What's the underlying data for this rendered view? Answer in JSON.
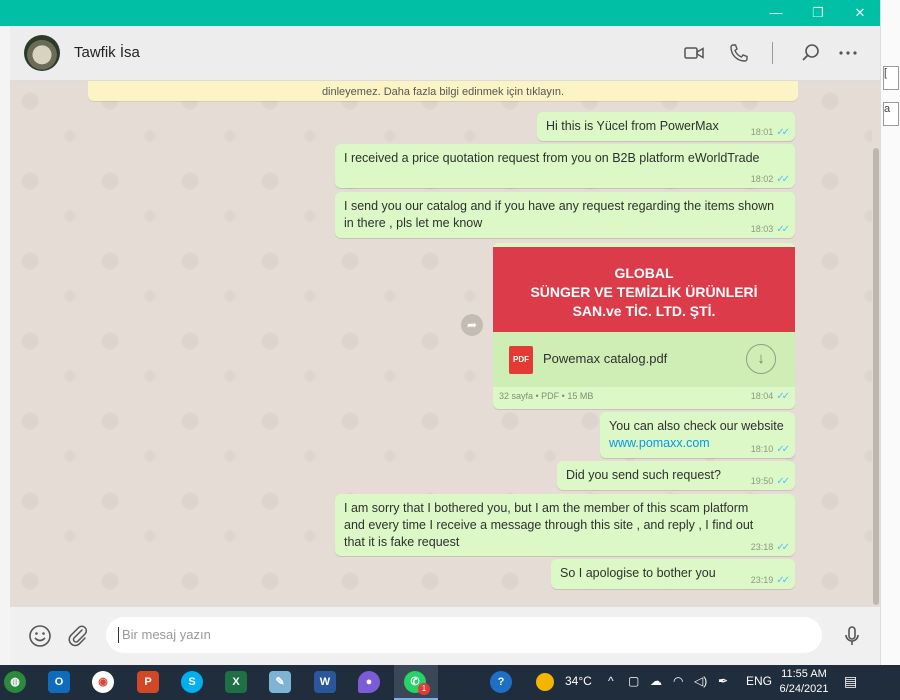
{
  "window": {
    "minimize": "—",
    "maximize": "❐",
    "close": "✕"
  },
  "side_panel": {
    "tab1": "[",
    "tab2": "a"
  },
  "header": {
    "contact_name": "Tawfik İsa",
    "icons": [
      "video-call-icon",
      "voice-call-icon",
      "search-icon",
      "menu-icon"
    ]
  },
  "notice": {
    "text": "dinleyemez. Daha fazla bilgi edinmek için tıklayın."
  },
  "messages": [
    {
      "text": "Hi this is Yücel from PowerMax",
      "time": "18:01"
    },
    {
      "text": "I received a price quotation request from you on B2B platform eWorldTrade",
      "time": "18:02"
    },
    {
      "line1": "I send you our catalog and if you have any request regarding the items shown",
      "line2": "in there , pls let me know",
      "time": "18:03"
    },
    {
      "line1": "You can also check our website",
      "link": "www.pomaxx.com",
      "time": "18:10"
    },
    {
      "text": "Did you send such request?",
      "time": "19:50"
    },
    {
      "line1": "I am sorry that I bothered you, but I am the member of this scam platform",
      "line2": "and every time I receive a message through this site , and reply , I find out",
      "line3": "that it is fake request",
      "time": "23:18"
    },
    {
      "text": "So I apologise to bother you",
      "time": "23:19"
    }
  ],
  "document": {
    "banner_line1": "GLOBAL",
    "banner_line2": "SÜNGER VE TEMİZLİK ÜRÜNLERİ",
    "banner_line3": "SAN.ve TİC. LTD. ŞTİ.",
    "file_type": "PDF",
    "file_name": "Powemax catalog.pdf",
    "meta": "32 sayfa • PDF • 15 MB",
    "time": "18:04"
  },
  "ticks": "✓✓",
  "input": {
    "placeholder": "Bir mesaj yazın"
  },
  "taskbar": {
    "apps": [
      "outlook",
      "chrome",
      "powerpoint",
      "skype",
      "excel",
      "notepad",
      "word",
      "paint",
      "whatsapp"
    ],
    "whatsapp_badge": "1",
    "temperature": "34°C",
    "language": "ENG",
    "time": "11:55 AM",
    "date": "6/24/2021"
  },
  "colors": {
    "titlebar": "#00bfa5",
    "outgoing_bubble": "#dcf8c6",
    "chat_background": "#e5ddd5",
    "read_ticks": "#4fc3f7",
    "banner": "#dc3c4a"
  }
}
